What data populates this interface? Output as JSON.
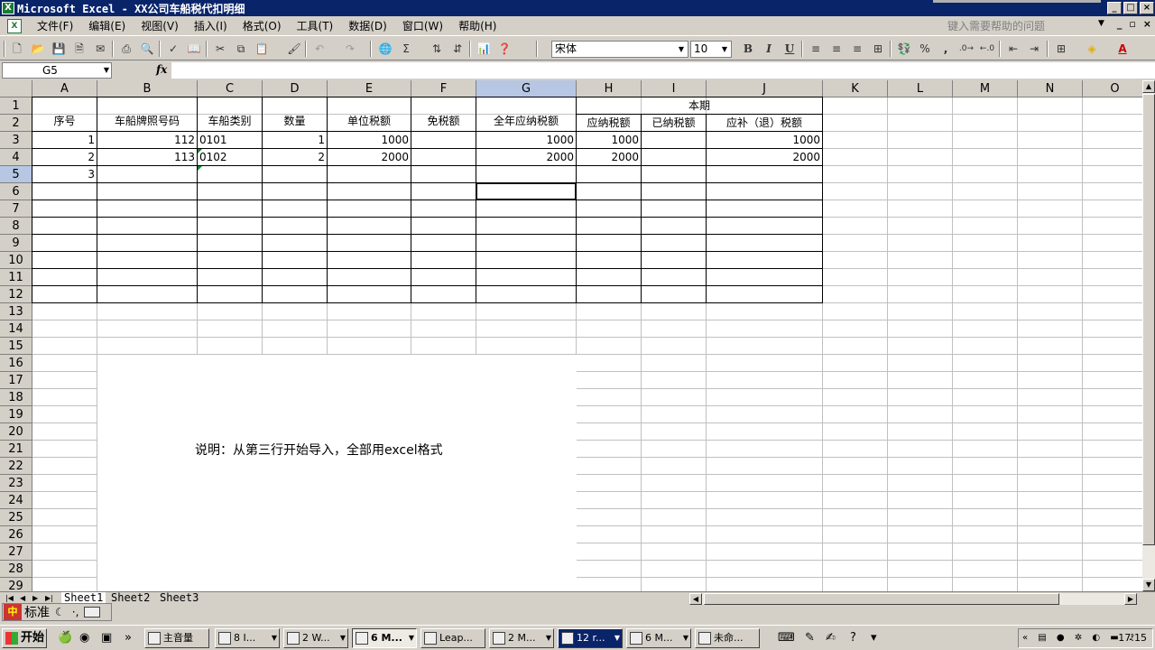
{
  "window": {
    "title": "Microsoft Excel - XX公司车船税代扣明细",
    "controls": [
      "_",
      "□",
      "×"
    ]
  },
  "menu": {
    "items": [
      "文件(F)",
      "编辑(E)",
      "视图(V)",
      "插入(I)",
      "格式(O)",
      "工具(T)",
      "数据(D)",
      "窗口(W)",
      "帮助(H)"
    ],
    "help_placeholder": "键入需要帮助的问题"
  },
  "toolbar": {
    "font_name": "宋体",
    "font_size": "10",
    "bold": "B",
    "italic": "I",
    "underline": "U",
    "percent": "%",
    "comma": ","
  },
  "formula_bar": {
    "cell_ref": "G5",
    "fx": "fx",
    "value": ""
  },
  "grid": {
    "columns": [
      "A",
      "B",
      "C",
      "D",
      "E",
      "F",
      "G",
      "H",
      "I",
      "J",
      "K",
      "L",
      "M",
      "N",
      "O"
    ],
    "selected_column": "G",
    "rows": [
      "1",
      "2",
      "3",
      "4",
      "5",
      "6",
      "7",
      "8",
      "9",
      "10",
      "11",
      "12",
      "13",
      "14",
      "15",
      "16",
      "17",
      "18",
      "19",
      "20",
      "21",
      "22",
      "23",
      "24",
      "25",
      "26",
      "27",
      "28",
      "29"
    ],
    "selected_row": "5",
    "headers": {
      "seq": "序号",
      "plate": "车船牌照号码",
      "category": "车船类别",
      "qty": "数量",
      "unit_tax": "单位税额",
      "exempt": "免税额",
      "annual_tax": "全年应纳税额",
      "period": "本期",
      "payable": "应纳税额",
      "paid": "已纳税额",
      "refund": "应补（退）税额"
    },
    "data_rows": [
      {
        "seq": "1",
        "plate": "112",
        "category": "0101",
        "qty": "1",
        "unit_tax": "1000",
        "exempt": "",
        "annual_tax": "1000",
        "payable": "1000",
        "paid": "",
        "refund": "1000"
      },
      {
        "seq": "2",
        "plate": "113",
        "category": "0102",
        "qty": "2",
        "unit_tax": "2000",
        "exempt": "",
        "annual_tax": "2000",
        "payable": "2000",
        "paid": "",
        "refund": "2000"
      },
      {
        "seq": "3",
        "plate": "",
        "category": "",
        "qty": "",
        "unit_tax": "",
        "exempt": "",
        "annual_tax": "",
        "payable": "",
        "paid": "",
        "refund": ""
      }
    ],
    "note": "说明：从第三行开始导入，全部用excel格式"
  },
  "sheets": [
    "Sheet1",
    "Sheet2",
    "Sheet3"
  ],
  "active_sheet": "Sheet1",
  "ime": {
    "mode": "标准"
  },
  "taskbar": {
    "start": "开始",
    "tasks": [
      "主音量",
      "8 I...",
      "2 W...",
      "6 M...",
      "Leap...",
      "2 M...",
      "12 r...",
      "6 M...",
      "未命..."
    ],
    "clock": "17:15"
  },
  "colors": {
    "titlebar": "#0a246a",
    "chrome": "#d4d0c8",
    "header_selected": "#b6c6e3",
    "gridline": "#c0c0c0",
    "error_triangle": "#1a7f3c"
  }
}
